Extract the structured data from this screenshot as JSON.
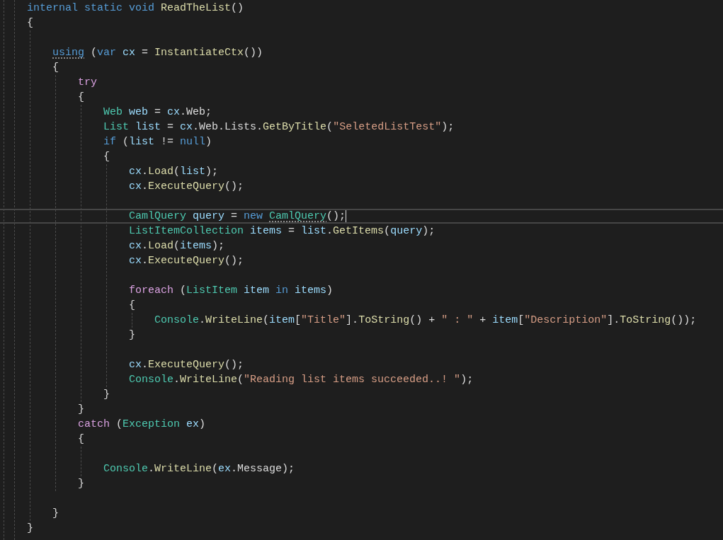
{
  "editor": {
    "lines": [
      {
        "kind": "line",
        "tokens": [
          {
            "kind": "kw",
            "text": "internal static void "
          },
          {
            "kind": "fn",
            "text": "ReadTheList"
          },
          {
            "kind": "txt",
            "text": "()"
          }
        ]
      },
      {
        "kind": "line",
        "tokens": [
          {
            "kind": "txt",
            "text": "{"
          }
        ]
      },
      {
        "kind": "block",
        "children": [
          {
            "kind": "blank"
          },
          {
            "kind": "line",
            "tokens": [
              {
                "kind": "kw",
                "text": "using",
                "hint": true
              },
              {
                "kind": "txt",
                "text": " ("
              },
              {
                "kind": "kw",
                "text": "var "
              },
              {
                "kind": "var",
                "text": "cx"
              },
              {
                "kind": "txt",
                "text": " = "
              },
              {
                "kind": "fn",
                "text": "InstantiateCtx"
              },
              {
                "kind": "txt",
                "text": "())"
              }
            ]
          },
          {
            "kind": "line",
            "tokens": [
              {
                "kind": "txt",
                "text": "{"
              }
            ]
          },
          {
            "kind": "block",
            "children": [
              {
                "kind": "line",
                "tokens": [
                  {
                    "kind": "ctl",
                    "text": "try"
                  }
                ]
              },
              {
                "kind": "line",
                "tokens": [
                  {
                    "kind": "txt",
                    "text": "{"
                  }
                ]
              },
              {
                "kind": "block",
                "children": [
                  {
                    "kind": "line",
                    "tokens": [
                      {
                        "kind": "type",
                        "text": "Web "
                      },
                      {
                        "kind": "var",
                        "text": "web"
                      },
                      {
                        "kind": "txt",
                        "text": " = "
                      },
                      {
                        "kind": "var",
                        "text": "cx"
                      },
                      {
                        "kind": "txt",
                        "text": ".Web;"
                      }
                    ]
                  },
                  {
                    "kind": "line",
                    "tokens": [
                      {
                        "kind": "type",
                        "text": "List "
                      },
                      {
                        "kind": "var",
                        "text": "list"
                      },
                      {
                        "kind": "txt",
                        "text": " = "
                      },
                      {
                        "kind": "var",
                        "text": "cx"
                      },
                      {
                        "kind": "txt",
                        "text": ".Web.Lists."
                      },
                      {
                        "kind": "fn",
                        "text": "GetByTitle"
                      },
                      {
                        "kind": "txt",
                        "text": "("
                      },
                      {
                        "kind": "str",
                        "text": "\"SeletedListTest\""
                      },
                      {
                        "kind": "txt",
                        "text": ");"
                      }
                    ]
                  },
                  {
                    "kind": "line",
                    "tokens": [
                      {
                        "kind": "kw",
                        "text": "if "
                      },
                      {
                        "kind": "txt",
                        "text": "("
                      },
                      {
                        "kind": "var",
                        "text": "list"
                      },
                      {
                        "kind": "txt",
                        "text": " != "
                      },
                      {
                        "kind": "kw",
                        "text": "null"
                      },
                      {
                        "kind": "txt",
                        "text": ")"
                      }
                    ]
                  },
                  {
                    "kind": "line",
                    "tokens": [
                      {
                        "kind": "txt",
                        "text": "{"
                      }
                    ]
                  },
                  {
                    "kind": "block",
                    "children": [
                      {
                        "kind": "line",
                        "tokens": [
                          {
                            "kind": "var",
                            "text": "cx"
                          },
                          {
                            "kind": "txt",
                            "text": "."
                          },
                          {
                            "kind": "fn",
                            "text": "Load"
                          },
                          {
                            "kind": "txt",
                            "text": "("
                          },
                          {
                            "kind": "var",
                            "text": "list"
                          },
                          {
                            "kind": "txt",
                            "text": ");"
                          }
                        ]
                      },
                      {
                        "kind": "line",
                        "tokens": [
                          {
                            "kind": "var",
                            "text": "cx"
                          },
                          {
                            "kind": "txt",
                            "text": "."
                          },
                          {
                            "kind": "fn",
                            "text": "ExecuteQuery"
                          },
                          {
                            "kind": "txt",
                            "text": "();"
                          }
                        ]
                      },
                      {
                        "kind": "blank"
                      },
                      {
                        "kind": "line",
                        "current": true,
                        "tokens": [
                          {
                            "kind": "type",
                            "text": "CamlQuery "
                          },
                          {
                            "kind": "var",
                            "text": "query"
                          },
                          {
                            "kind": "txt",
                            "text": " = "
                          },
                          {
                            "kind": "kw",
                            "text": "new "
                          },
                          {
                            "kind": "type",
                            "text": "CamlQuery",
                            "hint": true
                          },
                          {
                            "kind": "txt",
                            "text": "();"
                          }
                        ]
                      },
                      {
                        "kind": "line",
                        "tokens": [
                          {
                            "kind": "type",
                            "text": "ListItemCollection "
                          },
                          {
                            "kind": "var",
                            "text": "items"
                          },
                          {
                            "kind": "txt",
                            "text": " = "
                          },
                          {
                            "kind": "var",
                            "text": "list"
                          },
                          {
                            "kind": "txt",
                            "text": "."
                          },
                          {
                            "kind": "fn",
                            "text": "GetItems"
                          },
                          {
                            "kind": "txt",
                            "text": "("
                          },
                          {
                            "kind": "var",
                            "text": "query"
                          },
                          {
                            "kind": "txt",
                            "text": ");"
                          }
                        ]
                      },
                      {
                        "kind": "line",
                        "tokens": [
                          {
                            "kind": "var",
                            "text": "cx"
                          },
                          {
                            "kind": "txt",
                            "text": "."
                          },
                          {
                            "kind": "fn",
                            "text": "Load"
                          },
                          {
                            "kind": "txt",
                            "text": "("
                          },
                          {
                            "kind": "var",
                            "text": "items"
                          },
                          {
                            "kind": "txt",
                            "text": ");"
                          }
                        ]
                      },
                      {
                        "kind": "line",
                        "tokens": [
                          {
                            "kind": "var",
                            "text": "cx"
                          },
                          {
                            "kind": "txt",
                            "text": "."
                          },
                          {
                            "kind": "fn",
                            "text": "ExecuteQuery"
                          },
                          {
                            "kind": "txt",
                            "text": "();"
                          }
                        ]
                      },
                      {
                        "kind": "blank"
                      },
                      {
                        "kind": "line",
                        "tokens": [
                          {
                            "kind": "ctl",
                            "text": "foreach"
                          },
                          {
                            "kind": "txt",
                            "text": " ("
                          },
                          {
                            "kind": "type",
                            "text": "ListItem "
                          },
                          {
                            "kind": "var",
                            "text": "item"
                          },
                          {
                            "kind": "kw",
                            "text": " in "
                          },
                          {
                            "kind": "var",
                            "text": "items"
                          },
                          {
                            "kind": "txt",
                            "text": ")"
                          }
                        ]
                      },
                      {
                        "kind": "line",
                        "tokens": [
                          {
                            "kind": "txt",
                            "text": "{"
                          }
                        ]
                      },
                      {
                        "kind": "block",
                        "children": [
                          {
                            "kind": "line",
                            "tokens": [
                              {
                                "kind": "type",
                                "text": "Console"
                              },
                              {
                                "kind": "txt",
                                "text": "."
                              },
                              {
                                "kind": "fn",
                                "text": "WriteLine"
                              },
                              {
                                "kind": "txt",
                                "text": "("
                              },
                              {
                                "kind": "var",
                                "text": "item"
                              },
                              {
                                "kind": "txt",
                                "text": "["
                              },
                              {
                                "kind": "str",
                                "text": "\"Title\""
                              },
                              {
                                "kind": "txt",
                                "text": "]."
                              },
                              {
                                "kind": "fn",
                                "text": "ToString"
                              },
                              {
                                "kind": "txt",
                                "text": "() + "
                              },
                              {
                                "kind": "str",
                                "text": "\" : \""
                              },
                              {
                                "kind": "txt",
                                "text": " + "
                              },
                              {
                                "kind": "var",
                                "text": "item"
                              },
                              {
                                "kind": "txt",
                                "text": "["
                              },
                              {
                                "kind": "str",
                                "text": "\"Description\""
                              },
                              {
                                "kind": "txt",
                                "text": "]."
                              },
                              {
                                "kind": "fn",
                                "text": "ToString"
                              },
                              {
                                "kind": "txt",
                                "text": "());"
                              }
                            ]
                          }
                        ]
                      },
                      {
                        "kind": "line",
                        "tokens": [
                          {
                            "kind": "txt",
                            "text": "}"
                          }
                        ]
                      },
                      {
                        "kind": "blank"
                      },
                      {
                        "kind": "line",
                        "tokens": [
                          {
                            "kind": "var",
                            "text": "cx"
                          },
                          {
                            "kind": "txt",
                            "text": "."
                          },
                          {
                            "kind": "fn",
                            "text": "ExecuteQuery"
                          },
                          {
                            "kind": "txt",
                            "text": "();"
                          }
                        ]
                      },
                      {
                        "kind": "line",
                        "tokens": [
                          {
                            "kind": "type",
                            "text": "Console"
                          },
                          {
                            "kind": "txt",
                            "text": "."
                          },
                          {
                            "kind": "fn",
                            "text": "WriteLine"
                          },
                          {
                            "kind": "txt",
                            "text": "("
                          },
                          {
                            "kind": "str",
                            "text": "\"Reading list items succeeded..! \""
                          },
                          {
                            "kind": "txt",
                            "text": ");"
                          }
                        ]
                      }
                    ]
                  },
                  {
                    "kind": "line",
                    "tokens": [
                      {
                        "kind": "txt",
                        "text": "}"
                      }
                    ]
                  }
                ]
              },
              {
                "kind": "line",
                "tokens": [
                  {
                    "kind": "txt",
                    "text": "}"
                  }
                ]
              },
              {
                "kind": "line",
                "tokens": [
                  {
                    "kind": "ctl",
                    "text": "catch"
                  },
                  {
                    "kind": "txt",
                    "text": " ("
                  },
                  {
                    "kind": "type",
                    "text": "Exception "
                  },
                  {
                    "kind": "var",
                    "text": "ex"
                  },
                  {
                    "kind": "txt",
                    "text": ")"
                  }
                ]
              },
              {
                "kind": "line",
                "tokens": [
                  {
                    "kind": "txt",
                    "text": "{"
                  }
                ]
              },
              {
                "kind": "block",
                "children": [
                  {
                    "kind": "blank"
                  },
                  {
                    "kind": "line",
                    "tokens": [
                      {
                        "kind": "type",
                        "text": "Console"
                      },
                      {
                        "kind": "txt",
                        "text": "."
                      },
                      {
                        "kind": "fn",
                        "text": "WriteLine"
                      },
                      {
                        "kind": "txt",
                        "text": "("
                      },
                      {
                        "kind": "var",
                        "text": "ex"
                      },
                      {
                        "kind": "txt",
                        "text": ".Message);"
                      }
                    ]
                  }
                ]
              },
              {
                "kind": "line",
                "tokens": [
                  {
                    "kind": "txt",
                    "text": "}"
                  }
                ]
              }
            ]
          },
          {
            "kind": "blank"
          },
          {
            "kind": "line",
            "tokens": [
              {
                "kind": "txt",
                "text": "}"
              }
            ]
          }
        ]
      },
      {
        "kind": "line",
        "tokens": [
          {
            "kind": "txt",
            "text": "}"
          }
        ]
      }
    ]
  }
}
